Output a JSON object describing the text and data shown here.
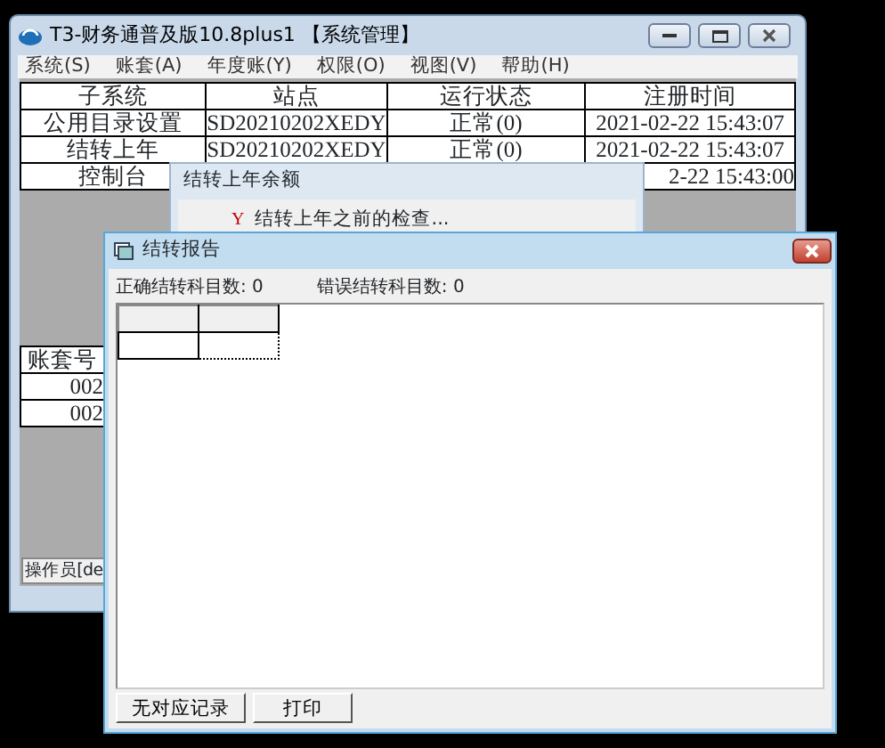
{
  "main_window": {
    "title": "T3-财务通普及版10.8plus1 【系统管理】",
    "menu": [
      "系统(S)",
      "账套(A)",
      "年度账(Y)",
      "权限(O)",
      "视图(V)",
      "帮助(H)"
    ],
    "subsystem_table": {
      "columns": [
        "子系统",
        "站点",
        "运行状态",
        "注册时间"
      ],
      "rows": [
        [
          "公用目录设置",
          "SD20210202XEDY",
          "正常(0)",
          "2021-02-22 15:43:07"
        ],
        [
          "结转上年",
          "SD20210202XEDY",
          "正常(0)",
          "2021-02-22 15:43:07"
        ],
        [
          "控制台",
          null,
          null,
          "2-22 15:43:00"
        ]
      ]
    },
    "account_table": {
      "columns": [
        "账套号"
      ],
      "rows": [
        [
          "002"
        ],
        [
          "002"
        ]
      ]
    },
    "status_bar": "操作员[de"
  },
  "balance_dialog": {
    "title": "结转上年余额",
    "step": {
      "mark": "Y",
      "text": "结转上年之前的检查..."
    }
  },
  "report_window": {
    "title": "结转报告",
    "counts": [
      {
        "label": "正确结转科目数:",
        "value": "0"
      },
      {
        "label": "错误结转科目数:",
        "value": "0"
      }
    ],
    "buttons": [
      "无对应记录",
      "打印"
    ]
  }
}
